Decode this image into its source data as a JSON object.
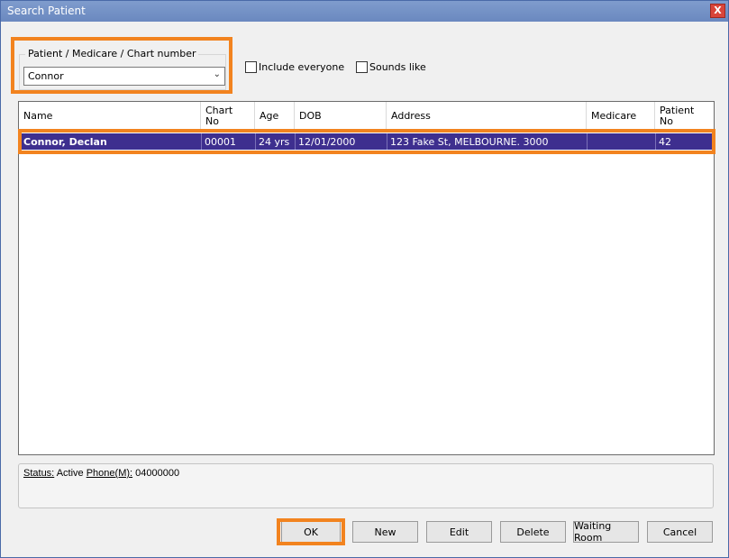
{
  "window": {
    "title": "Search Patient",
    "close_label": "X"
  },
  "search": {
    "group_label": "Patient / Medicare / Chart number",
    "value": "Connor",
    "include_everyone_label": "Include everyone",
    "sounds_like_label": "Sounds like"
  },
  "grid": {
    "columns": [
      {
        "key": "name",
        "label": "Name"
      },
      {
        "key": "chart_no",
        "label": "Chart No"
      },
      {
        "key": "age",
        "label": "Age"
      },
      {
        "key": "dob",
        "label": "DOB"
      },
      {
        "key": "address",
        "label": "Address"
      },
      {
        "key": "medicare",
        "label": "Medicare"
      },
      {
        "key": "patient_no",
        "label": "Patient No"
      }
    ],
    "rows": [
      {
        "name": "Connor, Declan",
        "chart_no": "00001",
        "age": "24 yrs",
        "dob": "12/01/2000",
        "address": "123 Fake St, MELBOURNE. 3000",
        "medicare": "",
        "patient_no": "42"
      }
    ]
  },
  "status": {
    "status_label": "Status:",
    "status_value": " Active ",
    "phone_label": "Phone(M):",
    "phone_value": " 04000000"
  },
  "buttons": {
    "ok": "OK",
    "new": "New",
    "edit": "Edit",
    "delete": "Delete",
    "waiting_room": "Waiting Room",
    "cancel": "Cancel"
  },
  "colors": {
    "highlight": "#f2831f",
    "selection": "#3e2f8f",
    "titlebar": "#7390c6"
  }
}
